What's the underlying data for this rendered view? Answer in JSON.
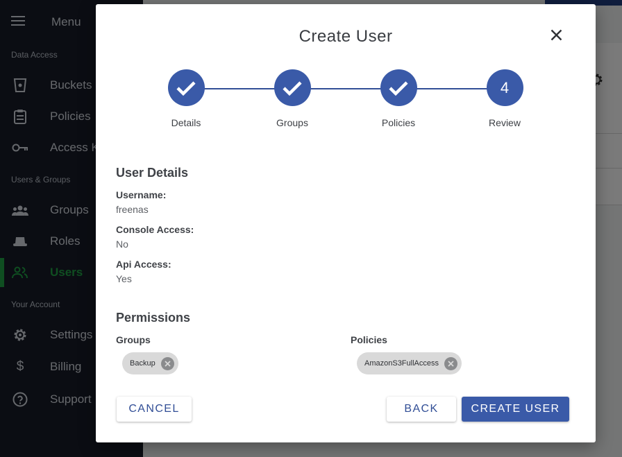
{
  "sidebar": {
    "menu_label": "Menu",
    "sections": [
      "Data Access",
      "Users & Groups",
      "Your Account"
    ],
    "items": [
      {
        "label": "Buckets",
        "icon": "bucket-icon"
      },
      {
        "label": "Policies",
        "icon": "clipboard-icon"
      },
      {
        "label": "Access Keys",
        "icon": "key-icon"
      },
      {
        "label": "Groups",
        "icon": "groups-icon"
      },
      {
        "label": "Roles",
        "icon": "roles-icon"
      },
      {
        "label": "Users",
        "icon": "users-icon",
        "active": true
      },
      {
        "label": "Settings",
        "icon": "gear-icon"
      },
      {
        "label": "Billing",
        "icon": "dollar-icon"
      },
      {
        "label": "Support",
        "icon": "help-icon"
      }
    ]
  },
  "modal": {
    "title": "Create User",
    "steps": [
      {
        "label": "Details",
        "done": true
      },
      {
        "label": "Groups",
        "done": true
      },
      {
        "label": "Policies",
        "done": true
      },
      {
        "label": "Review",
        "number": "4",
        "done": false
      }
    ],
    "user_details": {
      "title": "User Details",
      "username_label": "Username:",
      "username_value": "freenas",
      "console_label": "Console Access:",
      "console_value": "No",
      "api_label": "Api Access:",
      "api_value": "Yes"
    },
    "permissions": {
      "title": "Permissions",
      "groups_label": "Groups",
      "groups": [
        "Backup"
      ],
      "policies_label": "Policies",
      "policies": [
        "AmazonS3FullAccess"
      ]
    },
    "buttons": {
      "cancel": "CANCEL",
      "back": "BACK",
      "create": "CREATE USER"
    }
  },
  "colors": {
    "accent": "#3a5aa8",
    "active_nav": "#1f9c43",
    "sidebar_bg": "#161b26"
  }
}
